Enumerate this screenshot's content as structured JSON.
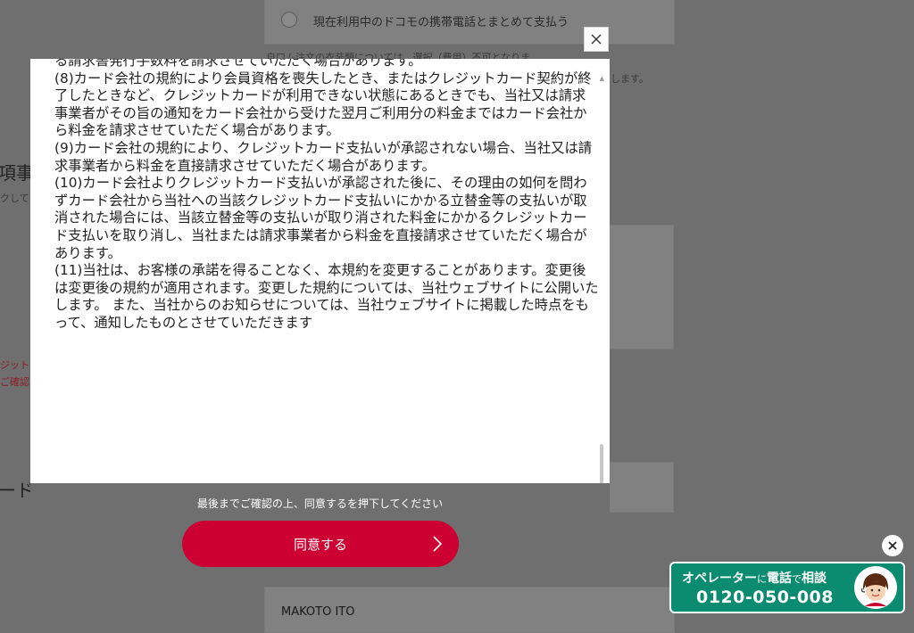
{
  "background": {
    "payment_option": "現在利用中のドコモの携帯電話とまとめて支払う",
    "note_line": "自口ム注文の衣装類については、選択（費用）不可となりま",
    "note_line_end": "します。",
    "heading_fragment": "項事項",
    "subtext_fragment": "クして",
    "card_heading_fragment": "ード番",
    "red_line_1": "ジットカ",
    "red_line_2": "ご確認",
    "name_value": "MAKOTO ITO"
  },
  "modal": {
    "paragraphs": [
      "る請求書発行手数料を請求させていただく場合があります。",
      "(8)カード会社の規約により会員資格を喪失したとき、またはクレジットカード契約が終了したときなど、クレジットカードが利用できない状態にあるときでも、当社又は請求事業者がその旨の通知をカード会社から受けた翌月ご利用分の料金まではカード会社から料金を請求させていただく場合があります。",
      "(9)カード会社の規約により、クレジットカード支払いが承認されない場合、当社又は請求事業者から料金を直接請求させていただく場合があります。",
      "(10)カード会社よりクレジットカード支払いが承認された後に、その理由の如何を問わずカード会社から当社への当該クレジットカード支払いにかかる立替金等の支払いが取消された場合には、当該立替金等の支払いが取り消された料金にかかるクレジットカード支払いを取り消し、当社または請求事業者から料金を直接請求させていただく場合があります。",
      "(11)当社は、お客様の承諾を得ることなく、本規約を変更することがあります。変更後は変更後の規約が適用されます。変更した規約については、当社ウェブサイトに公開いたします。 また、当社からのお知らせについては、当社ウェブサイトに掲載した時点をもって、通知したものとさせていただきます"
    ],
    "footer_note": "最後までご確認の上、同意するを押下してください",
    "agree_label": "同意する",
    "close_icon": "close-icon"
  },
  "operator": {
    "title_a": "オペレーター",
    "title_b": "に",
    "title_c": "電話",
    "title_d": "で",
    "title_e": "相談",
    "phone": "0120-050-008"
  },
  "colors": {
    "accent": "#cc0033",
    "operator_green": "#0b8b6f",
    "overlay": "#6f6f6f"
  }
}
